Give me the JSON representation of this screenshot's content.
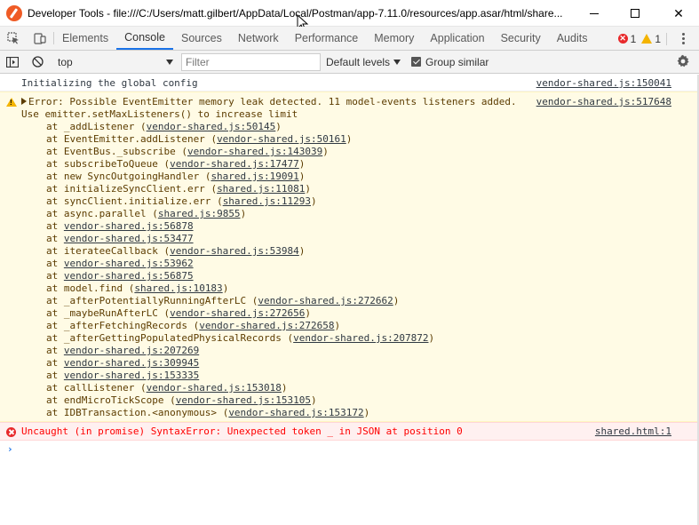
{
  "window": {
    "title": "Developer Tools - file:///C:/Users/matt.gilbert/AppData/Local/Postman/app-7.11.0/resources/app.asar/html/share...",
    "minimize_glyph": "",
    "maximize_glyph": "",
    "close_glyph": "✕"
  },
  "tabs": [
    "Elements",
    "Console",
    "Sources",
    "Network",
    "Performance",
    "Memory",
    "Application",
    "Security",
    "Audits"
  ],
  "active_tab": "Console",
  "counts": {
    "errors": "1",
    "warnings": "1"
  },
  "toolbar": {
    "context": "top",
    "filter_placeholder": "Filter",
    "levels": "Default levels",
    "group_similar": "Group similar"
  },
  "messages": {
    "info": {
      "text": "Initializing the global config",
      "source": "vendor-shared.js:150041"
    },
    "warning": {
      "line1": "Error: Possible EventEmitter memory leak detected. 11 model-events listeners added.",
      "line2": "Use emitter.setMaxListeners() to increase limit",
      "source": "vendor-shared.js:517648",
      "frames": [
        {
          "fn": "at _addListener ",
          "loc": "vendor-shared.js:50145"
        },
        {
          "fn": "at EventEmitter.addListener ",
          "loc": "vendor-shared.js:50161"
        },
        {
          "fn": "at EventBus._subscribe ",
          "loc": "vendor-shared.js:143039"
        },
        {
          "fn": "at subscribeToQueue ",
          "loc": "vendor-shared.js:17477"
        },
        {
          "fn": "at new SyncOutgoingHandler ",
          "loc": "shared.js:19091"
        },
        {
          "fn": "at initializeSyncClient.err ",
          "loc": "shared.js:11081"
        },
        {
          "fn": "at syncClient.initialize.err ",
          "loc": "shared.js:11293"
        },
        {
          "fn": "at async.parallel ",
          "loc": "shared.js:9855"
        },
        {
          "fn": "at ",
          "loc": "vendor-shared.js:56878",
          "bare": true
        },
        {
          "fn": "at ",
          "loc": "vendor-shared.js:53477",
          "bare": true
        },
        {
          "fn": "at iterateeCallback ",
          "loc": "vendor-shared.js:53984"
        },
        {
          "fn": "at ",
          "loc": "vendor-shared.js:53962",
          "bare": true
        },
        {
          "fn": "at ",
          "loc": "vendor-shared.js:56875",
          "bare": true
        },
        {
          "fn": "at model.find ",
          "loc": "shared.js:10183"
        },
        {
          "fn": "at _afterPotentiallyRunningAfterLC ",
          "loc": "vendor-shared.js:272662"
        },
        {
          "fn": "at _maybeRunAfterLC ",
          "loc": "vendor-shared.js:272656"
        },
        {
          "fn": "at _afterFetchingRecords ",
          "loc": "vendor-shared.js:272658"
        },
        {
          "fn": "at _afterGettingPopulatedPhysicalRecords ",
          "loc": "vendor-shared.js:207872"
        },
        {
          "fn": "at ",
          "loc": "vendor-shared.js:207269",
          "bare": true
        },
        {
          "fn": "at ",
          "loc": "vendor-shared.js:309945",
          "bare": true
        },
        {
          "fn": "at ",
          "loc": "vendor-shared.js:153335",
          "bare": true
        },
        {
          "fn": "at callListener ",
          "loc": "vendor-shared.js:153018"
        },
        {
          "fn": "at endMicroTickScope ",
          "loc": "vendor-shared.js:153105"
        },
        {
          "fn": "at IDBTransaction.<anonymous> ",
          "loc": "vendor-shared.js:153172"
        }
      ]
    },
    "error": {
      "text": "Uncaught (in promise) SyntaxError: Unexpected token _ in JSON at position 0",
      "source": "shared.html:1"
    }
  },
  "prompt": "›"
}
